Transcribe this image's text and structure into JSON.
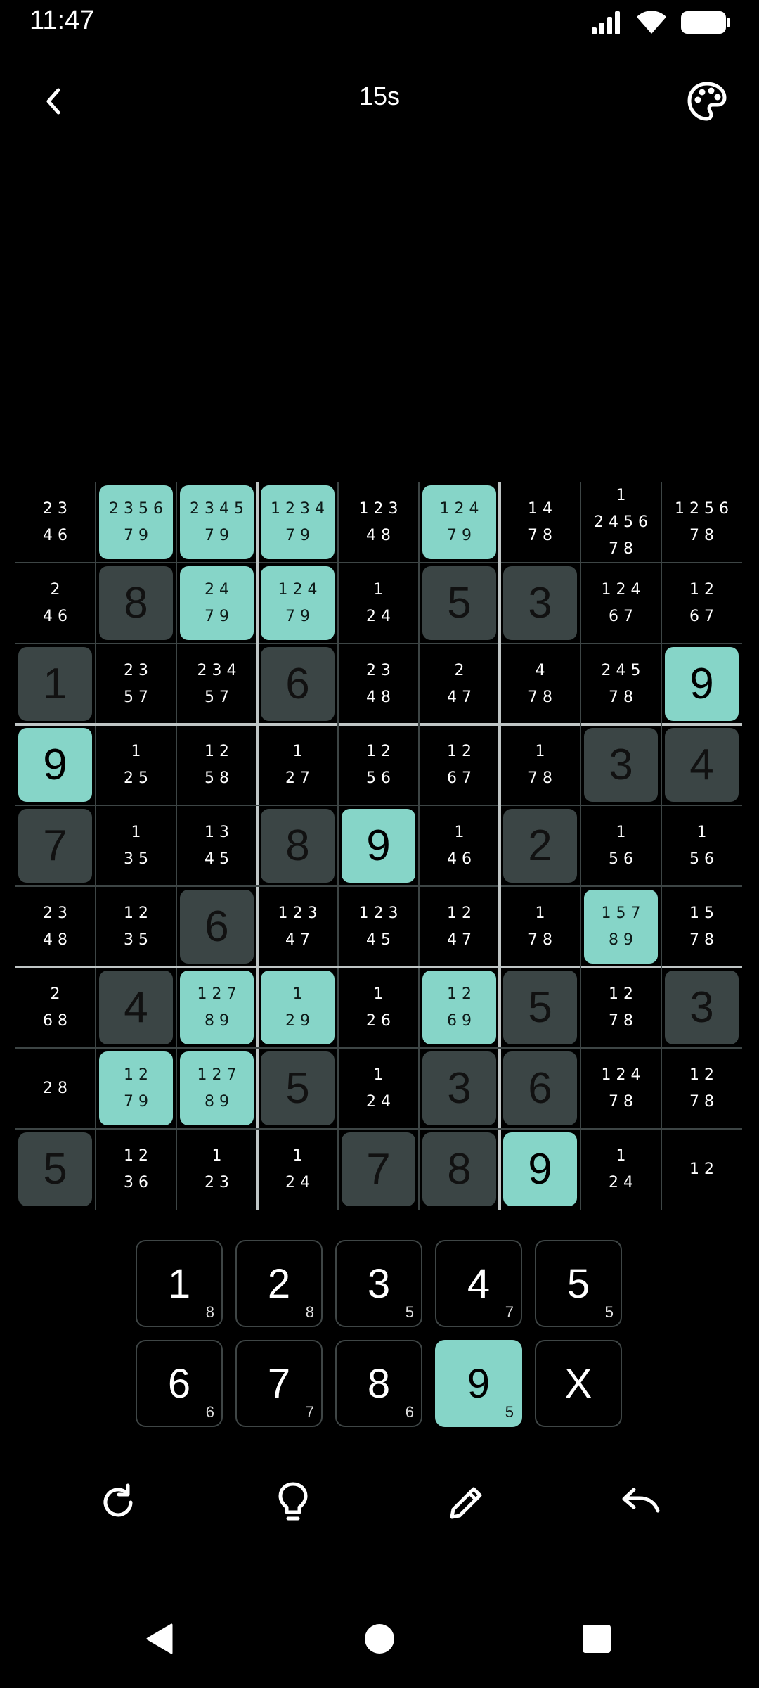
{
  "status_bar": {
    "time": "11:47"
  },
  "app_bar": {
    "timer": "15s",
    "back_icon": "chevron-left-icon",
    "theme_icon": "palette-icon"
  },
  "colors": {
    "accent": "#86d5c8",
    "given_tile": "#3b4545",
    "background": "#000000",
    "grid_line": "#3d4545",
    "box_line": "#bfc5c5"
  },
  "board": [
    [
      {
        "n": [
          "23",
          "46"
        ]
      },
      {
        "n": [
          "2356",
          "79"
        ],
        "hl": true
      },
      {
        "n": [
          "2345",
          "79"
        ],
        "hl": true
      },
      {
        "n": [
          "1234",
          "79"
        ],
        "hl": true
      },
      {
        "n": [
          "123",
          "48"
        ]
      },
      {
        "n": [
          "124",
          "79"
        ],
        "hl": true
      },
      {
        "n": [
          "14",
          "78"
        ]
      },
      {
        "n": [
          "1",
          "2456",
          "78"
        ]
      },
      {
        "n": [
          "1256",
          "78"
        ]
      }
    ],
    [
      {
        "n": [
          "2",
          "46"
        ]
      },
      {
        "v": "8",
        "given": true
      },
      {
        "n": [
          "24",
          "79"
        ],
        "hl": true
      },
      {
        "n": [
          "124",
          "79"
        ],
        "hl": true
      },
      {
        "n": [
          "1",
          "24"
        ]
      },
      {
        "v": "5",
        "given": true
      },
      {
        "v": "3",
        "given": true
      },
      {
        "n": [
          "124",
          "67"
        ]
      },
      {
        "n": [
          "12",
          "67"
        ]
      }
    ],
    [
      {
        "v": "1",
        "given": true
      },
      {
        "n": [
          "23",
          "57"
        ]
      },
      {
        "n": [
          "234",
          "57"
        ]
      },
      {
        "v": "6",
        "given": true
      },
      {
        "n": [
          "23",
          "48"
        ]
      },
      {
        "n": [
          "2",
          "47"
        ]
      },
      {
        "n": [
          "4",
          "78"
        ]
      },
      {
        "n": [
          "245",
          "78"
        ]
      },
      {
        "v": "9",
        "hl": true
      }
    ],
    [
      {
        "v": "9",
        "hl": true
      },
      {
        "n": [
          "1",
          "25"
        ]
      },
      {
        "n": [
          "12",
          "58"
        ]
      },
      {
        "n": [
          "1",
          "27"
        ]
      },
      {
        "n": [
          "12",
          "56"
        ]
      },
      {
        "n": [
          "12",
          "67"
        ]
      },
      {
        "n": [
          "1",
          "78"
        ]
      },
      {
        "v": "3",
        "given": true
      },
      {
        "v": "4",
        "given": true
      }
    ],
    [
      {
        "v": "7",
        "given": true
      },
      {
        "n": [
          "1",
          "35"
        ]
      },
      {
        "n": [
          "13",
          "45"
        ]
      },
      {
        "v": "8",
        "given": true
      },
      {
        "v": "9",
        "hl": true
      },
      {
        "n": [
          "1",
          "46"
        ]
      },
      {
        "v": "2",
        "given": true
      },
      {
        "n": [
          "1",
          "56"
        ]
      },
      {
        "n": [
          "1",
          "56"
        ]
      }
    ],
    [
      {
        "n": [
          "23",
          "48"
        ]
      },
      {
        "n": [
          "12",
          "35"
        ]
      },
      {
        "v": "6",
        "given": true
      },
      {
        "n": [
          "123",
          "47"
        ]
      },
      {
        "n": [
          "123",
          "45"
        ]
      },
      {
        "n": [
          "12",
          "47"
        ]
      },
      {
        "n": [
          "1",
          "78"
        ]
      },
      {
        "n": [
          "157",
          "89"
        ],
        "hl": true
      },
      {
        "n": [
          "15",
          "78"
        ]
      }
    ],
    [
      {
        "n": [
          "2",
          "68"
        ]
      },
      {
        "v": "4",
        "given": true
      },
      {
        "n": [
          "127",
          "89"
        ],
        "hl": true
      },
      {
        "n": [
          "1",
          "29"
        ],
        "hl": true
      },
      {
        "n": [
          "1",
          "26"
        ]
      },
      {
        "n": [
          "12",
          "69"
        ],
        "hl": true
      },
      {
        "v": "5",
        "given": true
      },
      {
        "n": [
          "12",
          "78"
        ]
      },
      {
        "v": "3",
        "given": true
      }
    ],
    [
      {
        "n": [
          "28"
        ]
      },
      {
        "n": [
          "12",
          "79"
        ],
        "hl": true
      },
      {
        "n": [
          "127",
          "89"
        ],
        "hl": true
      },
      {
        "v": "5",
        "given": true
      },
      {
        "n": [
          "1",
          "24"
        ]
      },
      {
        "v": "3",
        "given": true
      },
      {
        "v": "6",
        "given": true
      },
      {
        "n": [
          "124",
          "78"
        ]
      },
      {
        "n": [
          "12",
          "78"
        ]
      }
    ],
    [
      {
        "v": "5",
        "given": true
      },
      {
        "n": [
          "12",
          "36"
        ]
      },
      {
        "n": [
          "1",
          "23"
        ]
      },
      {
        "n": [
          "1",
          "24"
        ]
      },
      {
        "v": "7",
        "given": true
      },
      {
        "v": "8",
        "given": true
      },
      {
        "v": "9",
        "hl": true
      },
      {
        "n": [
          "1",
          "24"
        ]
      },
      {
        "n": [
          "12"
        ]
      }
    ]
  ],
  "number_pad": [
    {
      "digit": "1",
      "count": "8"
    },
    {
      "digit": "2",
      "count": "8"
    },
    {
      "digit": "3",
      "count": "5"
    },
    {
      "digit": "4",
      "count": "7"
    },
    {
      "digit": "5",
      "count": "5"
    },
    {
      "digit": "6",
      "count": "6"
    },
    {
      "digit": "7",
      "count": "7"
    },
    {
      "digit": "8",
      "count": "6"
    },
    {
      "digit": "9",
      "count": "5",
      "active": true
    },
    {
      "digit": "X",
      "count": ""
    }
  ],
  "tools": [
    "refresh-icon",
    "hint-lightbulb-icon",
    "pencil-icon",
    "undo-icon"
  ],
  "nav_bar": [
    "back-triangle-icon",
    "home-circle-icon",
    "recents-square-icon"
  ]
}
